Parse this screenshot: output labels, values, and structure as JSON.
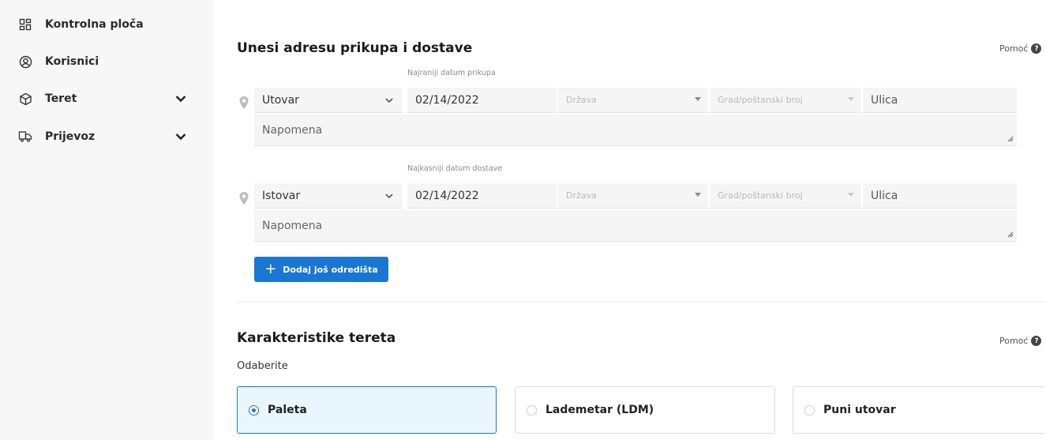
{
  "sidebar": {
    "items": [
      {
        "label": "Kontrolna ploča",
        "icon": "dashboard-icon",
        "has_submenu": false
      },
      {
        "label": "Korisnici",
        "icon": "users-icon",
        "has_submenu": false
      },
      {
        "label": "Teret",
        "icon": "cargo-box-icon",
        "has_submenu": true
      },
      {
        "label": "Prijevoz",
        "icon": "truck-icon",
        "has_submenu": true
      }
    ]
  },
  "address_section": {
    "title": "Unesi adresu prikupa i dostave",
    "help_label": "Pomoć",
    "pickup": {
      "date_label": "Najraniji datum prikupa",
      "type_value": "Utovar",
      "date_value": "02/14/2022",
      "country_placeholder": "Država",
      "city_placeholder": "Grad/poštanski broj",
      "street_placeholder": "Ulica",
      "note_placeholder": "Napomena"
    },
    "delivery": {
      "date_label": "Najkasniji datum dostave",
      "type_value": "Istovar",
      "date_value": "02/14/2022",
      "country_placeholder": "Država",
      "city_placeholder": "Grad/poštanski broj",
      "street_placeholder": "Ulica",
      "note_placeholder": "Napomena"
    },
    "add_button_label": "Dodaj još odredišta"
  },
  "cargo_section": {
    "title": "Karakteristike tereta",
    "help_label": "Pomoć",
    "subtitle": "Odaberite",
    "options": [
      {
        "label": "Paleta",
        "selected": true
      },
      {
        "label": "Lademetar (LDM)",
        "selected": false
      },
      {
        "label": "Puni utovar",
        "selected": false
      }
    ]
  },
  "colors": {
    "accent": "#1976d2",
    "selected_bg": "#e9f6fd",
    "sidebar_bg": "#f7f7f7",
    "field_bg": "#f5f5f5"
  }
}
